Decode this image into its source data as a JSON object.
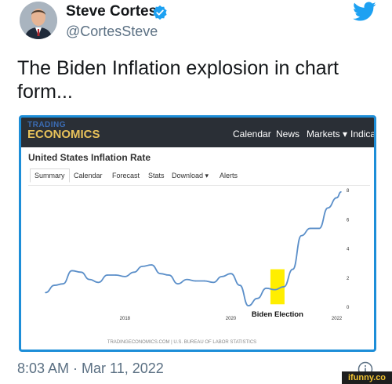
{
  "tweet": {
    "author_name": "Steve Cortes",
    "handle": "@CortesSteve",
    "text": "The Biden Inflation explosion in chart form...",
    "timestamp": "8:03 AM · Mar 11, 2022"
  },
  "colors": {
    "twitter_blue": "#1da1f2",
    "card_border": "#1d8ed8",
    "chart_line": "#5b8fc9",
    "highlight": "#ffee00"
  },
  "icons": {
    "verified": "verified-badge-icon",
    "twitter": "twitter-bird-icon",
    "info": "info-icon"
  },
  "te": {
    "logo_top": "TRADING",
    "logo": "ECONOMICS",
    "nav": [
      "Calendar",
      "News",
      "Markets ▾",
      "Indica"
    ],
    "title": "United States Inflation Rate",
    "tabs": [
      "Summary",
      "Calendar",
      "Forecast",
      "Stats",
      "Download ▾",
      "Alerts"
    ],
    "source": "TRADINGECONOMICS.COM | U.S. BUREAU OF LABOR STATISTICS"
  },
  "watermark": "ifunny.co",
  "chart_data": {
    "type": "line",
    "x": [
      2016.5,
      2016.67,
      2016.83,
      2017.0,
      2017.17,
      2017.33,
      2017.5,
      2017.67,
      2017.83,
      2018.0,
      2018.17,
      2018.33,
      2018.5,
      2018.67,
      2018.83,
      2019.0,
      2019.17,
      2019.33,
      2019.5,
      2019.67,
      2019.83,
      2020.0,
      2020.17,
      2020.33,
      2020.5,
      2020.67,
      2020.83,
      2021.0,
      2021.17,
      2021.33,
      2021.5,
      2021.67,
      2021.83,
      2022.0,
      2022.08
    ],
    "y": [
      1.0,
      1.5,
      1.6,
      2.5,
      2.4,
      1.9,
      1.7,
      2.2,
      2.2,
      2.1,
      2.4,
      2.8,
      2.9,
      2.3,
      2.2,
      1.6,
      1.9,
      1.8,
      1.8,
      1.7,
      2.1,
      2.3,
      1.5,
      0.1,
      0.6,
      1.3,
      1.2,
      1.4,
      2.6,
      4.9,
      5.4,
      5.4,
      6.8,
      7.5,
      7.9
    ],
    "x_ticks": [
      "2018",
      "2020",
      "2022"
    ],
    "y_ticks": [
      "0",
      "2",
      "4",
      "6",
      "8"
    ],
    "annotation": "Biden Election",
    "ylim": [
      0,
      8
    ]
  }
}
